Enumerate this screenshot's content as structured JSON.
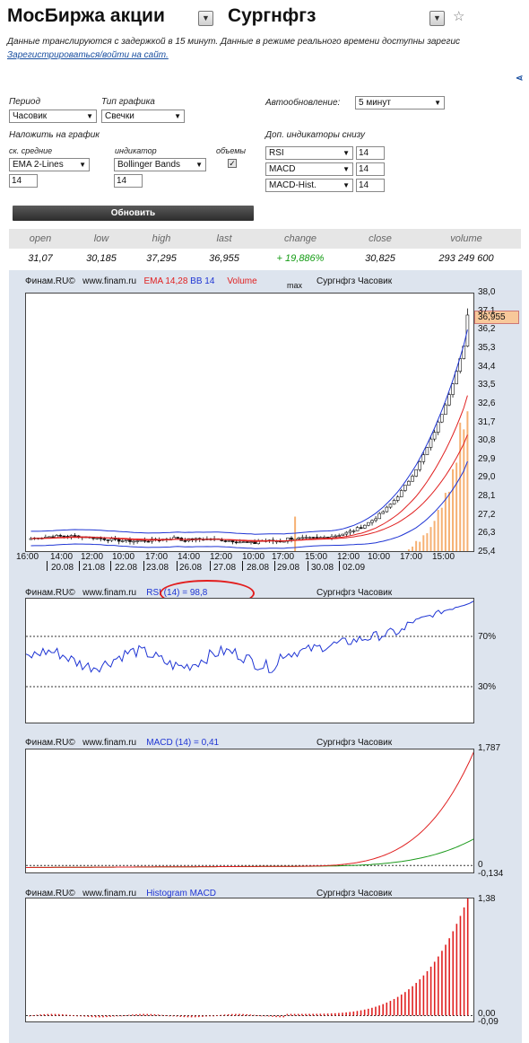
{
  "header": {
    "market": "МосБиржа акции",
    "ticker": "Сургнфгз",
    "notice": "Данные транслируются с задержкой в 15 минут. Данные в режиме реального времени доступны зарегис",
    "register_link": "Зарегистрироваться/войти на сайт.",
    "share_label": "<"
  },
  "form": {
    "period_label": "Период",
    "period_value": "Часовик",
    "chart_type_label": "Тип графика",
    "chart_type_value": "Свечки",
    "autorefresh_label": "Автообновление:",
    "autorefresh_value": "5 минут",
    "overlay_label": "Наложить на график",
    "ma_label": "ск. средние",
    "ma_value": "EMA 2-Lines",
    "ma_period": "14",
    "indicator_label": "индикатор",
    "indicator_value": "Bollinger Bands",
    "indicator_period": "14",
    "volumes_label": "объемы",
    "volumes_checked": true,
    "extra_label": "Доп. индикаторы снизу",
    "extra": [
      {
        "name": "RSI",
        "period": "14"
      },
      {
        "name": "MACD",
        "period": "14"
      },
      {
        "name": "MACD-Hist.",
        "period": "14"
      }
    ],
    "update_button": "Обновить"
  },
  "quote": {
    "headers": [
      "open",
      "low",
      "high",
      "last",
      "change",
      "close",
      "volume"
    ],
    "values": [
      "31,07",
      "30,185",
      "37,295",
      "36,955",
      "+ 19,886%",
      "30,825",
      "293 249 600"
    ]
  },
  "price_chart": {
    "source": "Финам.RU©",
    "site": "www.finam.ru",
    "ema_label": "EMA 14,28",
    "bb_label": "BB 14",
    "volume_label": "Volume",
    "max_label": "max",
    "title": "Сургнфгз Часовик",
    "current_price": "36,955",
    "y_ticks": [
      "38,0",
      "37,1",
      "36,2",
      "35,3",
      "34,4",
      "33,5",
      "32,6",
      "31,7",
      "30,8",
      "29,9",
      "29,0",
      "28,1",
      "27,2",
      "26,3",
      "25,4"
    ],
    "x_times": [
      "16:00",
      "14:00",
      "12:00",
      "10:00",
      "17:00",
      "14:00",
      "12:00",
      "10:00",
      "17:00",
      "15:00",
      "12:00",
      "10:00",
      "17:00",
      "15:00"
    ],
    "x_dates": [
      "20.08",
      "21.08",
      "22.08",
      "23.08",
      "26.08",
      "27.08",
      "28.08",
      "29.08",
      "30.08",
      "02.09"
    ]
  },
  "rsi_chart": {
    "source": "Финам.RU©",
    "site": "www.finam.ru",
    "label": "RSI (14) = 98,8",
    "title": "Сургнфгз Часовик",
    "level_high": "70%",
    "level_low": "30%"
  },
  "macd_chart": {
    "source": "Финам.RU©",
    "site": "www.finam.ru",
    "label": "MACD (14) = 0,41",
    "title": "Сургнфгз Часовик",
    "max": "1,787",
    "zero": "0",
    "min": "-0,134"
  },
  "hist_chart": {
    "source": "Финам.RU©",
    "site": "www.finam.ru",
    "label": "Histogram MACD",
    "title": "Сургнфгз Часовик",
    "max": "1,38",
    "zero": "0,00",
    "min": "-0,09"
  },
  "colors": {
    "candle_up": "#ffffff",
    "candle_down": "#111111",
    "ema": "#e02020",
    "bollinger": "#1f35d4",
    "volume": "#f5a35a",
    "rsi": "#1f35d4",
    "macd": "#e02020",
    "signal": "#1c9a1c",
    "histogram": "#e02020"
  }
}
